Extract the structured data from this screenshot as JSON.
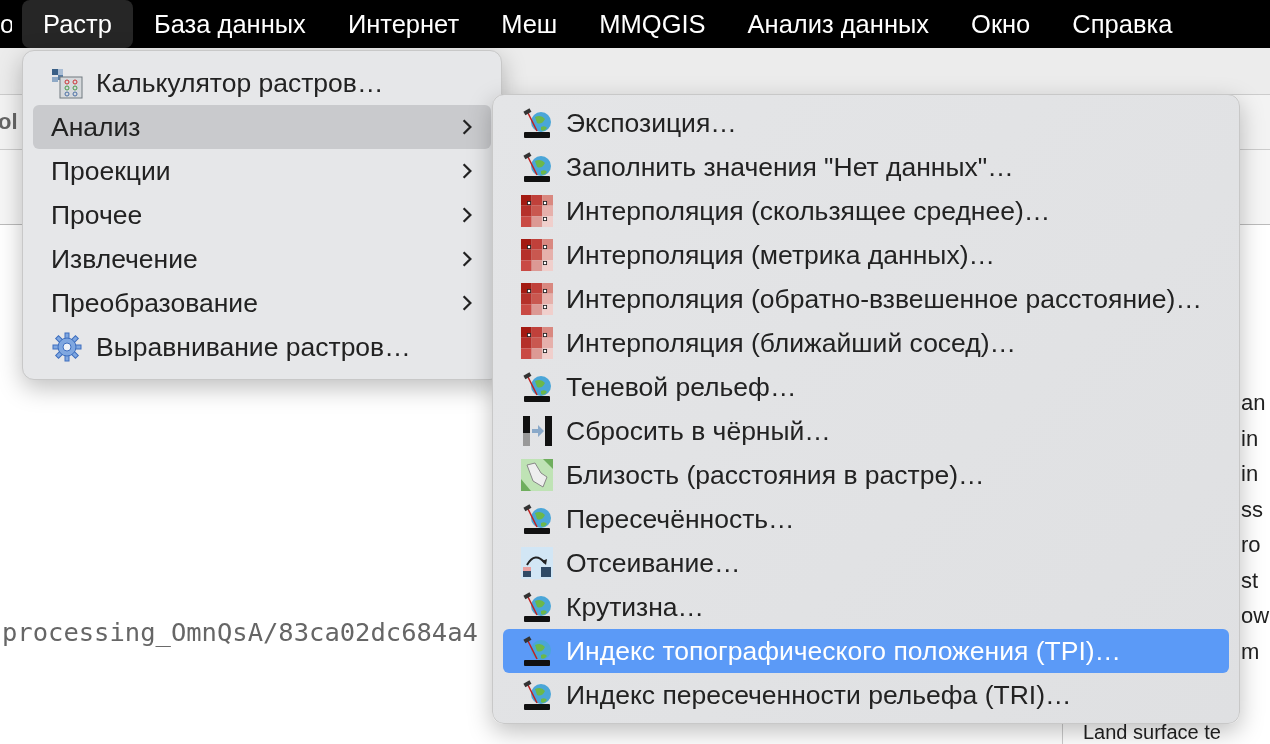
{
  "menubar": [
    {
      "label": "о",
      "selected": false
    },
    {
      "label": "Растр",
      "selected": true
    },
    {
      "label": "База данных",
      "selected": false
    },
    {
      "label": "Интернет",
      "selected": false
    },
    {
      "label": "Меш",
      "selected": false
    },
    {
      "label": "MMQGIS",
      "selected": false
    },
    {
      "label": "Анализ данных",
      "selected": false
    },
    {
      "label": "Окно",
      "selected": false
    },
    {
      "label": "Справка",
      "selected": false
    }
  ],
  "background": {
    "toolbar_label": "ol",
    "path_text": "processing_OmnQsA/83ca02dc684a4",
    "side_lines": [
      "an",
      "in",
      "in",
      "ss",
      "ro",
      "st",
      "ow",
      "m",
      "Land surface te"
    ]
  },
  "menu": [
    {
      "label": "Калькулятор растров…",
      "kind": "calculator",
      "selected": false
    },
    {
      "label": "Анализ",
      "kind": "submenu",
      "selected": true
    },
    {
      "label": "Проекции",
      "kind": "submenu",
      "selected": false
    },
    {
      "label": "Прочее",
      "kind": "submenu",
      "selected": false
    },
    {
      "label": "Извлечение",
      "kind": "submenu",
      "selected": false
    },
    {
      "label": "Преобразование",
      "kind": "submenu",
      "selected": false
    },
    {
      "label": "Выравнивание растров…",
      "kind": "gear",
      "selected": false
    }
  ],
  "submenu": [
    {
      "label": "Экспозиция…",
      "kind": "gdal",
      "selected": false
    },
    {
      "label": "Заполнить значения \"Нет данных\"…",
      "kind": "gdal",
      "selected": false
    },
    {
      "label": "Интерполяция (скользящее среднее)…",
      "kind": "grid",
      "selected": false
    },
    {
      "label": "Интерполяция (метрика данных)…",
      "kind": "grid",
      "selected": false
    },
    {
      "label": "Интерполяция (обратно-взвешенное расстояние)…",
      "kind": "grid",
      "selected": false
    },
    {
      "label": "Интерполяция (ближайший сосед)…",
      "kind": "grid",
      "selected": false
    },
    {
      "label": "Теневой рельеф…",
      "kind": "gdal",
      "selected": false
    },
    {
      "label": "Сбросить в чёрный…",
      "kind": "bars",
      "selected": false
    },
    {
      "label": "Близость (расстояния в растре)…",
      "kind": "proximity",
      "selected": false
    },
    {
      "label": "Пересечённость…",
      "kind": "gdal",
      "selected": false
    },
    {
      "label": "Отсеивание…",
      "kind": "sieve",
      "selected": false
    },
    {
      "label": "Крутизна…",
      "kind": "gdal",
      "selected": false
    },
    {
      "label": "Индекс топографического положения (TPI)…",
      "kind": "gdal",
      "selected": true
    },
    {
      "label": "Индекс пересеченности рельефа (TRI)…",
      "kind": "gdal",
      "selected": false
    }
  ]
}
